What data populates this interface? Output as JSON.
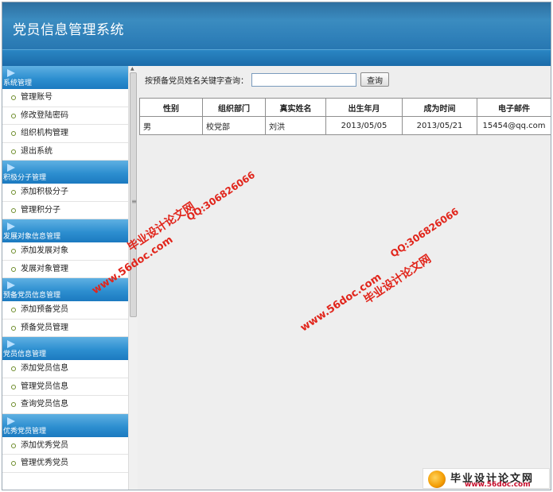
{
  "header": {
    "title": "党员信息管理系统"
  },
  "sidebar": {
    "groups": [
      {
        "title": "系统管理",
        "items": [
          "管理账号",
          "修改登陆密码",
          "组织机构管理",
          "退出系统"
        ]
      },
      {
        "title": "积极分子管理",
        "items": [
          "添加积极分子",
          "管理积分子"
        ]
      },
      {
        "title": "发展对象信息管理",
        "items": [
          "添加发展对象",
          "发展对象管理"
        ]
      },
      {
        "title": "预备党员信息管理",
        "items": [
          "添加预备党员",
          "预备党员管理"
        ]
      },
      {
        "title": "党员信息管理",
        "items": [
          "添加党员信息",
          "管理党员信息",
          "查询党员信息"
        ]
      },
      {
        "title": "优秀党员管理",
        "items": [
          "添加优秀党员",
          "管理优秀党员"
        ]
      }
    ]
  },
  "search": {
    "label": "按预备党员姓名关键字查询：",
    "value": "",
    "button": "查询"
  },
  "table": {
    "columns": [
      "性别",
      "组织部门",
      "真实姓名",
      "出生年月",
      "成为时间",
      "电子邮件"
    ],
    "rows": [
      [
        "男",
        "校党部",
        "刘洪",
        "2013/05/05",
        "2013/05/21",
        "15454@qq.com"
      ]
    ]
  },
  "watermarks": {
    "site": "www.56doc.com",
    "name": "毕业设计论文网",
    "qq": "QQ:306826066"
  },
  "footer_logo": {
    "name": "毕业设计论文网",
    "url": "www.56doc.com"
  },
  "colors": {
    "header_blue": "#2f80b9",
    "watermark_red": "#e1251b",
    "menu_dot_green": "#6d8c2a"
  }
}
